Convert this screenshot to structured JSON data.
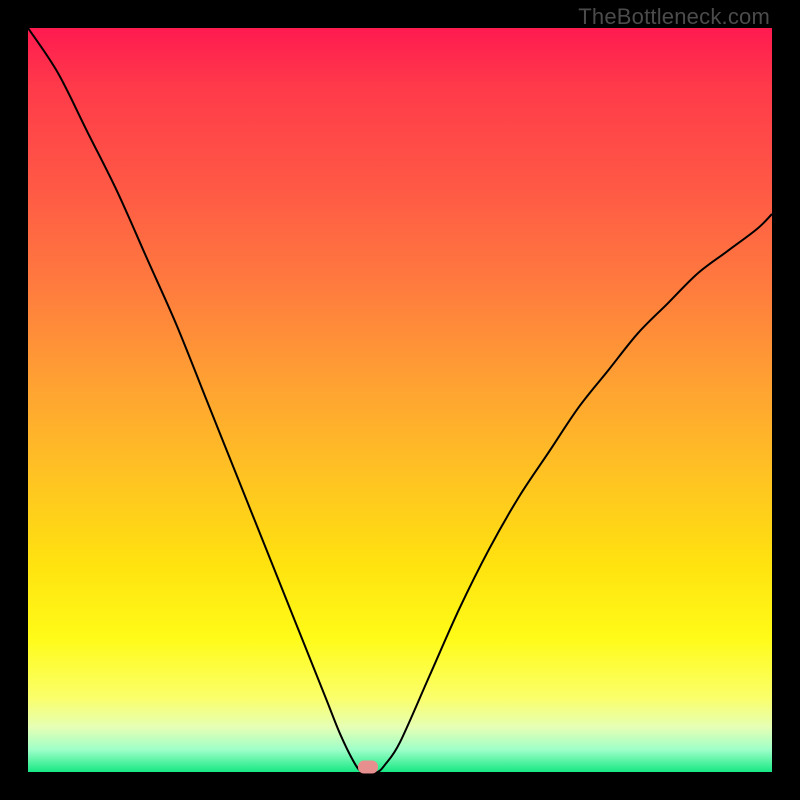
{
  "watermark": "TheBottleneck.com",
  "marker": {
    "color": "#e78f8f",
    "x_pct": 45.7,
    "y_pct": 99.3
  },
  "chart_data": {
    "type": "line",
    "title": "",
    "xlabel": "",
    "ylabel": "",
    "xlim": [
      0,
      100
    ],
    "ylim": [
      0,
      100
    ],
    "grid": false,
    "series": [
      {
        "name": "bottleneck-curve",
        "x": [
          0,
          4,
          8,
          12,
          16,
          20,
          24,
          28,
          32,
          36,
          40,
          42,
          44,
          45,
          46,
          47,
          48,
          50,
          54,
          58,
          62,
          66,
          70,
          74,
          78,
          82,
          86,
          90,
          94,
          98,
          100
        ],
        "values": [
          100,
          94,
          86,
          78,
          69,
          60,
          50,
          40,
          30,
          20,
          10,
          5,
          1,
          0,
          0,
          0,
          1,
          4,
          13,
          22,
          30,
          37,
          43,
          49,
          54,
          59,
          63,
          67,
          70,
          73,
          75
        ]
      }
    ],
    "annotations": [
      {
        "type": "point-marker",
        "x": 45.7,
        "y": 0.7,
        "color": "#e78f8f"
      }
    ],
    "background_gradient": {
      "direction": "vertical",
      "stops": [
        {
          "pos": 0.0,
          "color": "#ff1a50"
        },
        {
          "pos": 0.35,
          "color": "#ff7c3e"
        },
        {
          "pos": 0.72,
          "color": "#ffe20f"
        },
        {
          "pos": 0.94,
          "color": "#e5ffb5"
        },
        {
          "pos": 1.0,
          "color": "#17e884"
        }
      ]
    }
  }
}
